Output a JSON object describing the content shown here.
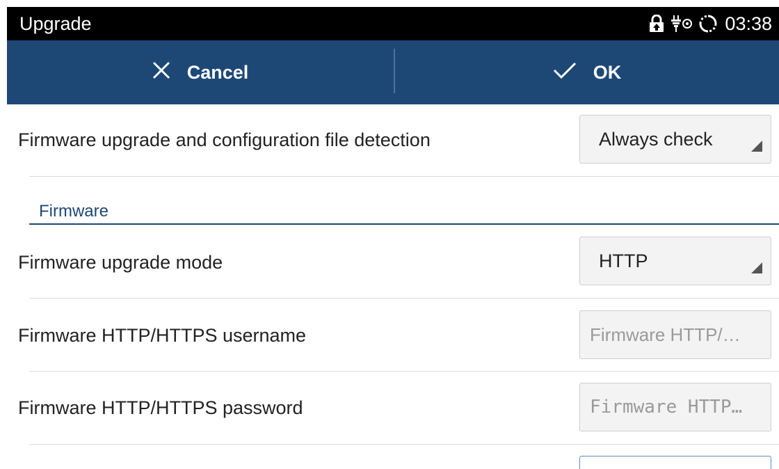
{
  "status_bar": {
    "title": "Upgrade",
    "time": "03:38",
    "icons": [
      "lock-icon",
      "usb-debug-icon",
      "sync-icon"
    ]
  },
  "action_bar": {
    "cancel_label": "Cancel",
    "ok_label": "OK",
    "background": "#1d4876"
  },
  "settings": {
    "detection": {
      "label": "Firmware upgrade and configuration file detection",
      "value": "Always check"
    },
    "firmware_section": {
      "header": "Firmware"
    },
    "upgrade_mode": {
      "label": "Firmware upgrade mode",
      "value": "HTTP"
    },
    "username": {
      "label": "Firmware HTTP/HTTPS username",
      "placeholder": "Firmware HTTP/…"
    },
    "password": {
      "label": "Firmware HTTP/HTTPS password",
      "placeholder": "Firmware HTTP…"
    }
  },
  "colors": {
    "accent": "#1d4876",
    "status_bar": "#000000",
    "text": "#222222",
    "placeholder": "#9a9a9a"
  }
}
